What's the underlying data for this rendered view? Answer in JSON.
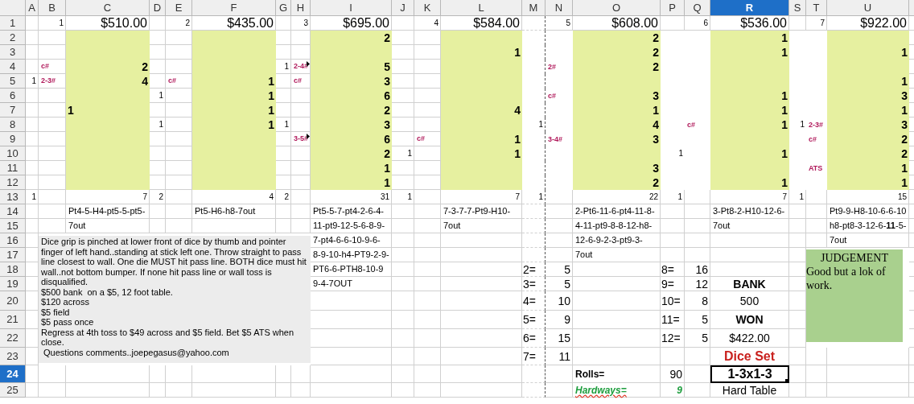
{
  "columns": [
    {
      "label": "A",
      "selected": false,
      "kind": "count"
    },
    {
      "label": "B",
      "selected": false,
      "kind": "note"
    },
    {
      "label": "C",
      "selected": false,
      "kind": "tally"
    },
    {
      "label": "D",
      "selected": false,
      "kind": "count"
    },
    {
      "label": "E",
      "selected": false,
      "kind": "note"
    },
    {
      "label": "F",
      "selected": false,
      "kind": "tally"
    },
    {
      "label": "G",
      "selected": false,
      "kind": "count"
    },
    {
      "label": "H",
      "selected": false,
      "kind": "note"
    },
    {
      "label": "I",
      "selected": false,
      "kind": "tally"
    },
    {
      "label": "J",
      "selected": false,
      "kind": "count"
    },
    {
      "label": "K",
      "selected": false,
      "kind": "note"
    },
    {
      "label": "L",
      "selected": false,
      "kind": "tally"
    },
    {
      "label": "M",
      "selected": false,
      "kind": "count"
    },
    {
      "label": "N",
      "selected": false,
      "kind": "note"
    },
    {
      "label": "O",
      "selected": false,
      "kind": "tally"
    },
    {
      "label": "P",
      "selected": false,
      "kind": "count"
    },
    {
      "label": "Q",
      "selected": false,
      "kind": "note"
    },
    {
      "label": "R",
      "selected": true,
      "kind": "tally"
    },
    {
      "label": "S",
      "selected": false,
      "kind": "count"
    },
    {
      "label": "T",
      "selected": false,
      "kind": "note"
    },
    {
      "label": "U",
      "selected": false,
      "kind": "tally"
    }
  ],
  "rows": [
    {
      "label": "1",
      "selected": false,
      "band": false,
      "cells": {
        "B": {
          "kind": "count",
          "text": "1"
        },
        "C": {
          "kind": "money",
          "text": "$510.00"
        },
        "E": {
          "kind": "count",
          "text": "2"
        },
        "F": {
          "kind": "money",
          "text": "$435.00"
        },
        "H": {
          "kind": "count",
          "text": "3"
        },
        "I": {
          "kind": "money",
          "text": "$695.00"
        },
        "K": {
          "kind": "count",
          "text": "4"
        },
        "L": {
          "kind": "money",
          "text": "$584.00"
        },
        "N": {
          "kind": "count",
          "text": "5"
        },
        "O": {
          "kind": "money",
          "text": "$608.00"
        },
        "Q": {
          "kind": "count",
          "text": "6"
        },
        "R": {
          "kind": "money",
          "text": "$536.00"
        },
        "T": {
          "kind": "count",
          "text": "7"
        },
        "U": {
          "kind": "money",
          "text": "$922.00"
        }
      }
    },
    {
      "label": "2",
      "selected": false,
      "band": true,
      "cells": {
        "I": {
          "kind": "tally",
          "text": "2"
        },
        "O": {
          "kind": "tally",
          "text": "2"
        },
        "R": {
          "kind": "tally",
          "text": "1"
        }
      }
    },
    {
      "label": "3",
      "selected": false,
      "band": true,
      "cells": {
        "L": {
          "kind": "tally",
          "text": "1"
        },
        "O": {
          "kind": "tally",
          "text": "2"
        },
        "R": {
          "kind": "tally",
          "text": "1"
        },
        "U": {
          "kind": "tally",
          "text": "1"
        }
      }
    },
    {
      "label": "4",
      "selected": false,
      "band": true,
      "cells": {
        "B": {
          "kind": "note",
          "text": "c#"
        },
        "C": {
          "kind": "tally",
          "text": "2"
        },
        "G": {
          "kind": "count",
          "text": "1"
        },
        "H": {
          "kind": "note",
          "text": "2-4#",
          "comment": true
        },
        "I": {
          "kind": "tally",
          "text": "5"
        },
        "N": {
          "kind": "note",
          "text": "2#"
        },
        "O": {
          "kind": "tally",
          "text": "2"
        }
      }
    },
    {
      "label": "5",
      "selected": false,
      "band": true,
      "cells": {
        "A": {
          "kind": "count",
          "text": "1"
        },
        "B": {
          "kind": "note",
          "text": "2-3#"
        },
        "C": {
          "kind": "tally",
          "text": "4"
        },
        "E": {
          "kind": "note",
          "text": "c#"
        },
        "F": {
          "kind": "tally",
          "text": "1"
        },
        "H": {
          "kind": "note",
          "text": "c#"
        },
        "I": {
          "kind": "tally",
          "text": "3"
        },
        "U": {
          "kind": "tally",
          "text": "1"
        }
      }
    },
    {
      "label": "6",
      "selected": false,
      "band": true,
      "cells": {
        "D": {
          "kind": "count",
          "text": "1"
        },
        "F": {
          "kind": "tally",
          "text": "1"
        },
        "I": {
          "kind": "tally",
          "text": "6"
        },
        "N": {
          "kind": "note",
          "text": "c#"
        },
        "O": {
          "kind": "tally",
          "text": "3"
        },
        "R": {
          "kind": "tally",
          "text": "1"
        },
        "U": {
          "kind": "tally",
          "text": "3"
        }
      }
    },
    {
      "label": "7",
      "selected": false,
      "band": true,
      "cells": {
        "C": {
          "kind": "tallyleft",
          "text": "1"
        },
        "F": {
          "kind": "tally",
          "text": "1"
        },
        "I": {
          "kind": "tally",
          "text": "2"
        },
        "L": {
          "kind": "tally",
          "text": "4"
        },
        "O": {
          "kind": "tally",
          "text": "1"
        },
        "R": {
          "kind": "tally",
          "text": "1"
        },
        "U": {
          "kind": "tally",
          "text": "1"
        }
      }
    },
    {
      "label": "8",
      "selected": false,
      "band": true,
      "cells": {
        "D": {
          "kind": "count",
          "text": "1"
        },
        "F": {
          "kind": "tally",
          "text": "1"
        },
        "G": {
          "kind": "count",
          "text": "1"
        },
        "I": {
          "kind": "tally",
          "text": "3"
        },
        "M": {
          "kind": "count",
          "text": "1"
        },
        "O": {
          "kind": "tally",
          "text": "4"
        },
        "Q": {
          "kind": "note",
          "text": "c#"
        },
        "R": {
          "kind": "tally",
          "text": "1"
        },
        "S": {
          "kind": "count",
          "text": "1"
        },
        "T": {
          "kind": "note",
          "text": "2-3#"
        },
        "U": {
          "kind": "tally",
          "text": "3"
        }
      }
    },
    {
      "label": "9",
      "selected": false,
      "band": true,
      "cells": {
        "H": {
          "kind": "note",
          "text": "3-5#",
          "comment": true
        },
        "I": {
          "kind": "tally",
          "text": "6"
        },
        "K": {
          "kind": "note",
          "text": "c#"
        },
        "L": {
          "kind": "tally",
          "text": "1"
        },
        "N": {
          "kind": "note",
          "text": "3-4#"
        },
        "O": {
          "kind": "tally",
          "text": "3"
        },
        "T": {
          "kind": "note",
          "text": "c#"
        },
        "U": {
          "kind": "tally",
          "text": "2"
        }
      }
    },
    {
      "label": "10",
      "selected": false,
      "band": true,
      "cells": {
        "I": {
          "kind": "tally",
          "text": "2"
        },
        "J": {
          "kind": "count",
          "text": "1"
        },
        "L": {
          "kind": "tally",
          "text": "1"
        },
        "P": {
          "kind": "count",
          "text": "1"
        },
        "R": {
          "kind": "tally",
          "text": "1"
        },
        "U": {
          "kind": "tally",
          "text": "2"
        }
      }
    },
    {
      "label": "11",
      "selected": false,
      "band": true,
      "cells": {
        "I": {
          "kind": "tally",
          "text": "1"
        },
        "O": {
          "kind": "tally",
          "text": "3"
        },
        "T": {
          "kind": "note",
          "text": "ATS"
        },
        "U": {
          "kind": "tally",
          "text": "1"
        }
      }
    },
    {
      "label": "12",
      "selected": false,
      "band": true,
      "cells": {
        "I": {
          "kind": "tally",
          "text": "1"
        },
        "O": {
          "kind": "tally",
          "text": "2"
        },
        "R": {
          "kind": "tally",
          "text": "1"
        },
        "U": {
          "kind": "tally",
          "text": "1"
        }
      }
    },
    {
      "label": "13",
      "selected": false,
      "band": false,
      "cells": {
        "A": {
          "kind": "count",
          "text": "1"
        },
        "C": {
          "kind": "count",
          "text": "7"
        },
        "D": {
          "kind": "count",
          "text": "2"
        },
        "F": {
          "kind": "count",
          "text": "4"
        },
        "G": {
          "kind": "count",
          "text": "2"
        },
        "I": {
          "kind": "count",
          "text": "31"
        },
        "J": {
          "kind": "count",
          "text": "1"
        },
        "L": {
          "kind": "count",
          "text": "7"
        },
        "M": {
          "kind": "count",
          "text": "1"
        },
        "O": {
          "kind": "count",
          "text": "22"
        },
        "P": {
          "kind": "count",
          "text": "1"
        },
        "R": {
          "kind": "count",
          "text": "7"
        },
        "S": {
          "kind": "count",
          "text": "1"
        },
        "U": {
          "kind": "count",
          "text": "15"
        }
      }
    },
    {
      "label": "14",
      "selected": false,
      "band": false,
      "cells": {
        "C": {
          "kind": "text",
          "text": "Pt4-5-H4-pt5-5-pt5-"
        },
        "F": {
          "kind": "text",
          "text": "Pt5-H6-h8-7out"
        },
        "I": {
          "kind": "text",
          "text": "Pt5-5-7-pt4-2-6-4-"
        },
        "L": {
          "kind": "text",
          "text": "7-3-7-7-Pt9-H10-"
        },
        "O": {
          "kind": "text",
          "text": "2-Pt6-11-6-pt4-11-8-"
        },
        "R": {
          "kind": "text",
          "text": "3-Pt8-2-H10-12-6-"
        },
        "U": {
          "kind": "text",
          "text": "Pt9-9-H8-10-6-6-10"
        }
      }
    },
    {
      "label": "15",
      "selected": false,
      "band": false,
      "cells": {
        "C": {
          "kind": "text",
          "text": "7out"
        },
        "I": {
          "kind": "text",
          "text": "11-pt9-12-5-6-8-9-"
        },
        "L": {
          "kind": "text",
          "text": "7out"
        },
        "O": {
          "kind": "text",
          "text": "4-11-pt9-8-8-12-h8-"
        },
        "R": {
          "kind": "text",
          "text": "7out"
        },
        "U": {
          "kind": "text",
          "text": "h8-pt8-3-12-6-**11**-5-"
        }
      }
    },
    {
      "label": "16",
      "selected": false,
      "band": false,
      "cells": {
        "I": {
          "kind": "text",
          "text": "7-pt4-6-6-10-9-6-"
        },
        "O": {
          "kind": "text",
          "text": "12-6-9-2-3-pt9-3-"
        },
        "U": {
          "kind": "text",
          "text": "7out"
        }
      }
    },
    {
      "label": "17",
      "selected": false,
      "band": false,
      "cells": {
        "I": {
          "kind": "text",
          "text": "8-9-10-h4-PT9-2-9-"
        },
        "O": {
          "kind": "text",
          "text": "7out"
        }
      }
    },
    {
      "label": "18",
      "selected": false,
      "band": false,
      "cells": {
        "I": {
          "kind": "text",
          "text": "PT6-6-PTH8-10-9"
        },
        "M": {
          "kind": "stat",
          "text": "2="
        },
        "N": {
          "kind": "number",
          "text": "5"
        },
        "P": {
          "kind": "stat",
          "text": "8="
        },
        "Q": {
          "kind": "number",
          "text": "16"
        }
      }
    },
    {
      "label": "19",
      "selected": false,
      "band": false,
      "cells": {
        "I": {
          "kind": "text",
          "text": "9-4-7OUT"
        },
        "M": {
          "kind": "stat",
          "text": "3="
        },
        "N": {
          "kind": "number",
          "text": "5"
        },
        "P": {
          "kind": "stat",
          "text": "9="
        },
        "Q": {
          "kind": "number",
          "text": "12"
        },
        "R": {
          "kind": "label",
          "text": "BANK"
        }
      }
    },
    {
      "label": "20",
      "selected": false,
      "band": false,
      "cells": {
        "M": {
          "kind": "stat",
          "text": "4="
        },
        "N": {
          "kind": "number",
          "text": "10"
        },
        "P": {
          "kind": "stat",
          "text": "10="
        },
        "Q": {
          "kind": "number",
          "text": "8"
        },
        "R": {
          "kind": "value",
          "text": "500"
        }
      }
    },
    {
      "label": "21",
      "selected": false,
      "band": false,
      "cells": {
        "M": {
          "kind": "stat",
          "text": "5="
        },
        "N": {
          "kind": "number",
          "text": "9"
        },
        "P": {
          "kind": "stat",
          "text": "11="
        },
        "Q": {
          "kind": "number",
          "text": "5"
        },
        "R": {
          "kind": "label",
          "text": "WON"
        }
      }
    },
    {
      "label": "22",
      "selected": false,
      "band": false,
      "cells": {
        "M": {
          "kind": "stat",
          "text": "6="
        },
        "N": {
          "kind": "number",
          "text": "15"
        },
        "P": {
          "kind": "stat",
          "text": "12="
        },
        "Q": {
          "kind": "number",
          "text": "5"
        },
        "R": {
          "kind": "value",
          "text": "$422.00"
        }
      }
    },
    {
      "label": "23",
      "selected": false,
      "band": false,
      "cells": {
        "M": {
          "kind": "stat",
          "text": "7="
        },
        "N": {
          "kind": "number",
          "text": "11"
        },
        "R": {
          "kind": "title",
          "text": "Dice Set"
        }
      }
    },
    {
      "label": "24",
      "selected": true,
      "band": false,
      "cells": {
        "O": {
          "kind": "total",
          "text": "Rolls="
        },
        "P": {
          "kind": "number",
          "text": "90"
        },
        "R": {
          "kind": "active",
          "text": "1-3x1-3"
        }
      }
    },
    {
      "label": "25",
      "selected": false,
      "band": false,
      "cells": {
        "O": {
          "kind": "hard",
          "text": "Hardways="
        },
        "P": {
          "kind": "hardnum",
          "text": "9"
        },
        "R": {
          "kind": "value",
          "text": "Hard Table"
        }
      }
    }
  ],
  "note_box": {
    "paragraphs": [
      "Dice grip is pinched at lower front of dice by thumb and pointer finger of left hand..standing at stick left one. Throw straight to pass line closest to wall. One die MUST hit pass line. BOTH dice must hit wall..not bottom bumper. If none hit pass line or wall toss is disqualified.",
      "$500 bank  on a $5, 12 foot table.",
      "$120 across",
      "$5 field",
      "$5 pass once",
      "Regress at 4th toss to $49 across and $5 field. Bet $5 ATS when close.",
      " Questions comments..joepegasus@yahoo.com"
    ]
  },
  "judgement_box": {
    "title": "JUDGEMENT",
    "text": "Good but a lok of work."
  }
}
